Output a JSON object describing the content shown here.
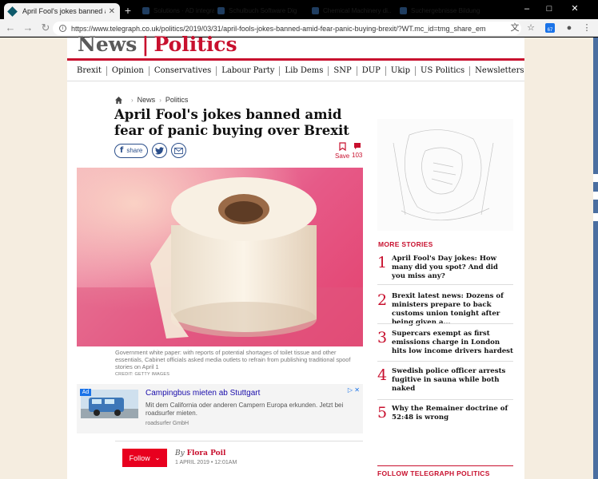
{
  "browser": {
    "active_tab_title": "April Fool's jokes banned amid f",
    "ghost_tabs": [
      "Solutions · AD integration",
      "Schulbuch Software Digital",
      "Chemical Machinery di...",
      "Suchergebnisse Bildung"
    ],
    "url": "https://www.telegraph.co.uk/politics/2019/03/31/april-fools-jokes-banned-amid-fear-panic-buying-brexit/?WT.mc_id=tmg_share_em",
    "extension_badge": "67"
  },
  "masthead": {
    "news": "News",
    "politics": "Politics"
  },
  "subnav": [
    "Brexit",
    "Opinion",
    "Conservatives",
    "Labour Party",
    "Lib Dems",
    "SNP",
    "DUP",
    "Ukip",
    "US Politics",
    "Newsletters"
  ],
  "breadcrumbs": [
    "News",
    "Politics"
  ],
  "article": {
    "headline": "April Fool's jokes banned amid fear of panic buying over Brexit",
    "share_label": "share",
    "save_label": "Save",
    "comment_count": "103",
    "caption": "Government white paper: with reports of potential shortages of toilet tissue and other essentials, Cabinet officials asked media outlets to refrain from publishing traditional spoof stories on April 1",
    "credit": "CREDIT: GETTY IMAGES",
    "byline_prefix": "By",
    "author": "Flora Poil",
    "date": "1 APRIL 2019 • 12:01AM",
    "follow_label": "Follow"
  },
  "ad": {
    "badge": "Ad",
    "title": "Campingbus mieten ab Stuttgart",
    "description": "Mit dem California oder anderen Campern Europa erkunden. Jetzt bei roadsurfer mieten.",
    "source": "roadsurfer GmbH"
  },
  "more_stories": {
    "title": "MORE STORIES",
    "items": [
      {
        "num": "1",
        "text": "April Fool's Day jokes: How many did you spot? And did you miss any?"
      },
      {
        "num": "2",
        "text": "Brexit latest news: Dozens of ministers prepare to back customs union tonight after being given a..."
      },
      {
        "num": "3",
        "text": "Supercars exempt as first emissions charge in London hits low income drivers hardest"
      },
      {
        "num": "4",
        "text": "Swedish police officer arrests fugitive in sauna while both naked"
      },
      {
        "num": "5",
        "text": "Why the Remainer doctrine of 52:48 is wrong"
      }
    ]
  },
  "follow_telegraph": "FOLLOW TELEGRAPH POLITICS",
  "colors": {
    "brand_red": "#c8102e",
    "follow_red": "#e8001f",
    "share_blue": "#2a4e8a"
  }
}
